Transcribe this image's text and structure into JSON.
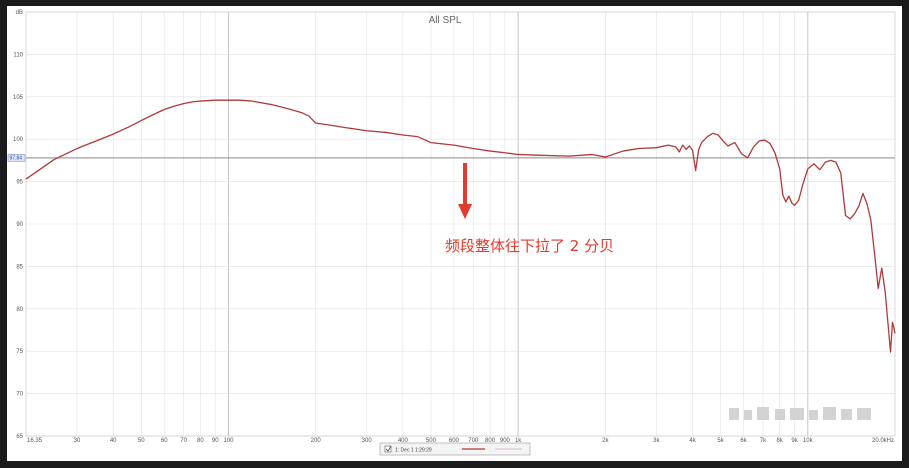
{
  "chart_data": {
    "type": "line",
    "title": "All SPL",
    "ylabel": "dB",
    "xlabel": "",
    "xscale": "log",
    "xlim": [
      20,
      20000
    ],
    "ylim": [
      65,
      115
    ],
    "grid": true,
    "x_ticks": [
      {
        "v": 20,
        "label": "16.35"
      },
      {
        "v": 30,
        "label": "30"
      },
      {
        "v": 40,
        "label": "40"
      },
      {
        "v": 50,
        "label": "50"
      },
      {
        "v": 60,
        "label": "60"
      },
      {
        "v": 70,
        "label": "70"
      },
      {
        "v": 80,
        "label": "80"
      },
      {
        "v": 90,
        "label": "90"
      },
      {
        "v": 100,
        "label": "100"
      },
      {
        "v": 200,
        "label": "200"
      },
      {
        "v": 300,
        "label": "300"
      },
      {
        "v": 400,
        "label": "400"
      },
      {
        "v": 500,
        "label": "500"
      },
      {
        "v": 600,
        "label": "600"
      },
      {
        "v": 700,
        "label": "700"
      },
      {
        "v": 800,
        "label": "800"
      },
      {
        "v": 900,
        "label": "900"
      },
      {
        "v": 1000,
        "label": "1k"
      },
      {
        "v": 2000,
        "label": "2k"
      },
      {
        "v": 3000,
        "label": "3k"
      },
      {
        "v": 4000,
        "label": "4k"
      },
      {
        "v": 5000,
        "label": "5k"
      },
      {
        "v": 6000,
        "label": "6k"
      },
      {
        "v": 7000,
        "label": "7k"
      },
      {
        "v": 8000,
        "label": "8k"
      },
      {
        "v": 9000,
        "label": "9k"
      },
      {
        "v": 10000,
        "label": "10k"
      },
      {
        "v": 20000,
        "label": "20.0kHz"
      }
    ],
    "y_ticks": [
      {
        "v": 65,
        "label": "65"
      },
      {
        "v": 70,
        "label": "70"
      },
      {
        "v": 75,
        "label": "75"
      },
      {
        "v": 80,
        "label": "80"
      },
      {
        "v": 85,
        "label": "85"
      },
      {
        "v": 90,
        "label": "90"
      },
      {
        "v": 95,
        "label": "95"
      },
      {
        "v": 100,
        "label": "100"
      },
      {
        "v": 105,
        "label": "105"
      },
      {
        "v": 110,
        "label": "110"
      },
      {
        "v": 115,
        "label": "dB"
      }
    ],
    "reference_line": {
      "y": 97.8,
      "label": "97.84"
    },
    "series": [
      {
        "name": "",
        "color": "#b03a3a",
        "points": [
          [
            20,
            95.3
          ],
          [
            25,
            97.6
          ],
          [
            30,
            98.9
          ],
          [
            35,
            99.8
          ],
          [
            40,
            100.6
          ],
          [
            45,
            101.4
          ],
          [
            50,
            102.2
          ],
          [
            55,
            102.9
          ],
          [
            60,
            103.5
          ],
          [
            65,
            103.9
          ],
          [
            70,
            104.2
          ],
          [
            75,
            104.4
          ],
          [
            80,
            104.5
          ],
          [
            90,
            104.6
          ],
          [
            100,
            104.6
          ],
          [
            110,
            104.6
          ],
          [
            120,
            104.5
          ],
          [
            140,
            104.1
          ],
          [
            160,
            103.6
          ],
          [
            180,
            103.1
          ],
          [
            190,
            102.7
          ],
          [
            200,
            101.9
          ],
          [
            220,
            101.7
          ],
          [
            250,
            101.4
          ],
          [
            300,
            101.0
          ],
          [
            350,
            100.8
          ],
          [
            400,
            100.5
          ],
          [
            450,
            100.3
          ],
          [
            500,
            99.6
          ],
          [
            600,
            99.3
          ],
          [
            700,
            98.9
          ],
          [
            800,
            98.6
          ],
          [
            900,
            98.4
          ],
          [
            1000,
            98.2
          ],
          [
            1200,
            98.1
          ],
          [
            1500,
            98.0
          ],
          [
            1800,
            98.2
          ],
          [
            2000,
            97.9
          ],
          [
            2300,
            98.6
          ],
          [
            2600,
            98.9
          ],
          [
            3000,
            99.0
          ],
          [
            3300,
            99.3
          ],
          [
            3500,
            99.1
          ],
          [
            3600,
            98.5
          ],
          [
            3700,
            99.3
          ],
          [
            3800,
            98.8
          ],
          [
            3900,
            99.2
          ],
          [
            4000,
            98.7
          ],
          [
            4100,
            96.3
          ],
          [
            4200,
            98.8
          ],
          [
            4300,
            99.6
          ],
          [
            4500,
            100.3
          ],
          [
            4700,
            100.7
          ],
          [
            4900,
            100.5
          ],
          [
            5100,
            99.8
          ],
          [
            5300,
            99.2
          ],
          [
            5600,
            99.6
          ],
          [
            5900,
            98.3
          ],
          [
            6200,
            97.8
          ],
          [
            6500,
            99.1
          ],
          [
            6800,
            99.8
          ],
          [
            7100,
            99.9
          ],
          [
            7400,
            99.5
          ],
          [
            7700,
            98.4
          ],
          [
            8000,
            96.5
          ],
          [
            8200,
            93.4
          ],
          [
            8400,
            92.6
          ],
          [
            8600,
            93.3
          ],
          [
            8800,
            92.5
          ],
          [
            9000,
            92.2
          ],
          [
            9300,
            92.8
          ],
          [
            9600,
            94.6
          ],
          [
            10000,
            96.5
          ],
          [
            10500,
            97.1
          ],
          [
            11000,
            96.4
          ],
          [
            11500,
            97.3
          ],
          [
            12000,
            97.5
          ],
          [
            12500,
            97.3
          ],
          [
            13000,
            96.0
          ],
          [
            13500,
            91.0
          ],
          [
            14000,
            90.6
          ],
          [
            14500,
            91.2
          ],
          [
            15000,
            92.1
          ],
          [
            15500,
            93.6
          ],
          [
            16000,
            92.4
          ],
          [
            16500,
            90.5
          ],
          [
            17000,
            86.5
          ],
          [
            17500,
            82.4
          ],
          [
            18000,
            84.8
          ],
          [
            18500,
            82.0
          ],
          [
            19000,
            77.5
          ],
          [
            19300,
            74.9
          ],
          [
            19600,
            78.4
          ],
          [
            19800,
            77.8
          ],
          [
            20000,
            77.1
          ]
        ]
      }
    ],
    "annotation": {
      "text": "频段整体往下拉了 2 分贝"
    },
    "legend": {
      "position": "bottom-center",
      "label": "1: Dec 1 1:29:29"
    }
  },
  "colors": {
    "curve": "#b03a3a",
    "grid": "#e2e2e2",
    "major_grid": "#c4c4c4",
    "reference": "#8a8a8a",
    "annotation": "#e23b2e",
    "background": "#1b1b1b",
    "plot_bg": "#ffffff"
  },
  "icons": {
    "arrow": "down-arrow-icon",
    "legend_checkbox": "checkbox-icon"
  }
}
